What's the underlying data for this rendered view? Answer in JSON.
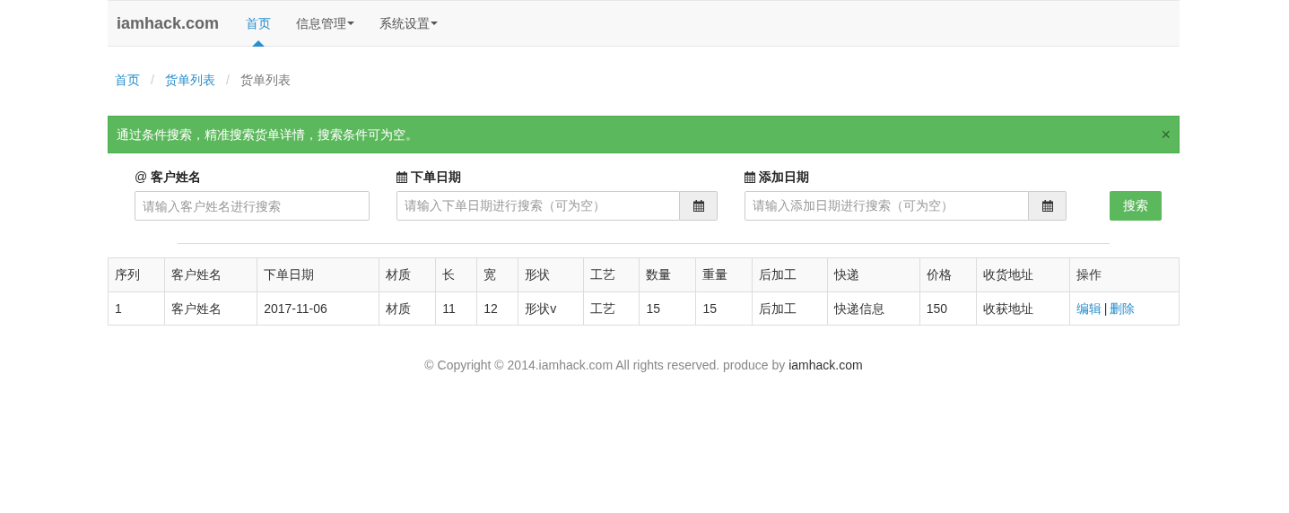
{
  "navbar": {
    "brand": "iamhack.com",
    "items": [
      {
        "label": "首页",
        "selected": true,
        "dropdown": false
      },
      {
        "label": "信息管理",
        "selected": false,
        "dropdown": true
      },
      {
        "label": "系统设置",
        "selected": false,
        "dropdown": true
      }
    ]
  },
  "breadcrumb_divider": "/",
  "breadcrumb": [
    {
      "label": "首页",
      "active": false
    },
    {
      "label": "货单列表",
      "active": false
    },
    {
      "label": "货单列表",
      "active": true
    }
  ],
  "alert": {
    "text": "通过条件搜索，精准搜索货单详情，搜索条件可为空。",
    "close": "×"
  },
  "search": {
    "fields": [
      {
        "kind": "text",
        "prefix": "@",
        "label": "客户姓名",
        "placeholder": "请输入客户姓名进行搜索"
      },
      {
        "kind": "date",
        "label": "下单日期",
        "placeholder": "请输入下单日期进行搜索（可为空）"
      },
      {
        "kind": "date",
        "label": "添加日期",
        "placeholder": "请输入添加日期进行搜索（可为空）"
      }
    ],
    "button": "搜索"
  },
  "table": {
    "columns": [
      "序列",
      "客户姓名",
      "下单日期",
      "材质",
      "长",
      "宽",
      "形状",
      "工艺",
      "数量",
      "重量",
      "后加工",
      "快递",
      "价格",
      "收货地址",
      "操作"
    ],
    "rows": [
      {
        "cells": [
          "1",
          "客户姓名",
          "2017-11-06",
          "材质",
          "11",
          "12",
          "形状v",
          "工艺",
          "15",
          "15",
          "后加工",
          "快递信息",
          "150",
          "收获地址"
        ],
        "actions": [
          "编辑",
          "删除"
        ],
        "separator": "|"
      }
    ]
  },
  "footer": {
    "text": "© Copyright © 2014.iamhack.com All rights reserved. produce by ",
    "link": "iamhack.com"
  }
}
